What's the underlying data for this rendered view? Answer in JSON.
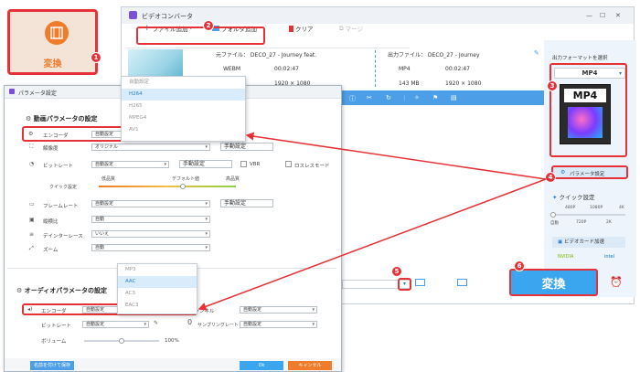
{
  "tile": {
    "label": "変換",
    "step": "1"
  },
  "converter": {
    "title": "ビデオコンバータ",
    "toolbar": {
      "add_file": "ファイル追加",
      "add_folder": "フォルダ追加",
      "clear": "クリア",
      "merge": "マージ",
      "step": "2"
    },
    "source": {
      "name": "元ファイル： DECO_27 - Journey feat.",
      "format": "WEBM",
      "duration": "00:02:47",
      "resolution": "1920 × 1080"
    },
    "output": {
      "name": "出力ファイル： DECO_27 - Journey",
      "format": "MP4",
      "duration": "00:02:47",
      "size": "143 MB",
      "resolution": "1920 × 1080"
    },
    "right_panel": {
      "select_format": "出力フォーマットを選択",
      "format": "MP4",
      "format_badge": "MP4",
      "step_format": "3",
      "param_button": "パラメータ設定",
      "step_param": "4",
      "quick_setting": "クイック設定",
      "res_top": [
        "480P",
        "1080P",
        "4K"
      ],
      "res_bottom": [
        "自動",
        "720P",
        "2K"
      ],
      "gpu": "ビデオカード加速",
      "nvidia": "NVIDIA",
      "intel": "intel"
    },
    "step_folder": "5",
    "convert_button": "変換",
    "step_convert": "6"
  },
  "dialog": {
    "title": "パラメータ設定",
    "video_section": "動画パラメータの設定",
    "encoder_label": "エンコーダ",
    "encoder_value": "自動設定",
    "resolution_label": "解像度",
    "resolution_value": "オリジナル",
    "manual_settings": "手動設定",
    "bitrate_label": "ビットレート",
    "bitrate_value": "自動設定",
    "vbr": "VBR",
    "lossless": "ロスレスモード",
    "quick_setting": "クイック設定",
    "low_quality": "低品質",
    "default_value": "デフォルト値",
    "high_quality": "高品質",
    "framerate_label": "フレームレート",
    "framerate_value": "自動設定",
    "aspect_label": "縦横比",
    "aspect_value": "自動",
    "deinterlace_label": "デインターレース",
    "deinterlace_value": "いいえ",
    "zoom_label": "ズーム",
    "zoom_value": "自動",
    "video_encoders": [
      "自動設定",
      "H264",
      "H265",
      "MPEG4",
      "AV1"
    ],
    "audio_section": "オーディオパラメータの設定",
    "audio_encoder_label": "エンコーダ",
    "audio_encoder_value": "自動設定",
    "audio_bitrate_label": "ビットレート",
    "audio_bitrate_value": "自動設定",
    "channel_label": "チャンネル",
    "channel_value": "自動設定",
    "samplerate_label": "サンプリングレート",
    "samplerate_value": "自動設定",
    "volume_label": "ボリューム",
    "volume_value": "100%",
    "audio_encoders": [
      "MP3",
      "AAC",
      "AC3",
      "EAC3"
    ],
    "save_button": "名前を付けて保存",
    "ok_button": "Ok",
    "cancel_button": "キャンセル"
  },
  "colors": {
    "accent_red": "#e53238",
    "blue": "#39a6ef",
    "orange": "#f07b2a"
  }
}
